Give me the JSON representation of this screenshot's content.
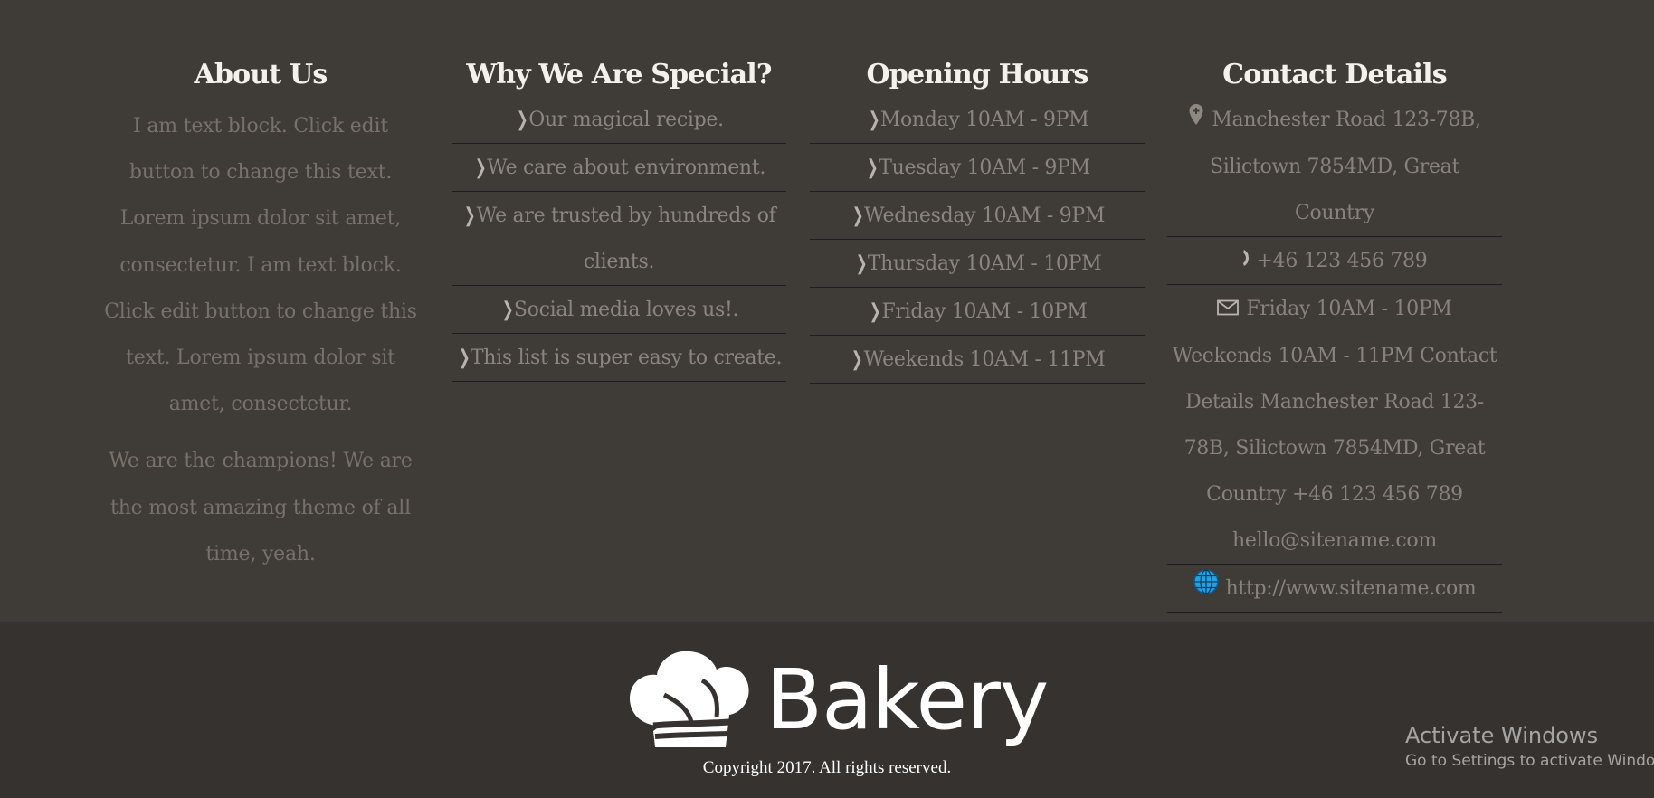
{
  "about": {
    "title": "About Us",
    "paragraph_1": "I am text block. Click edit button to change this text. Lorem ipsum dolor sit amet, consectetur. I am text block. Click edit button to change this text. Lorem ipsum dolor sit amet, consectetur.",
    "paragraph_2": "We are the champions! We are the most amazing theme of all time, yeah."
  },
  "special": {
    "title": "Why We Are Special?",
    "items": [
      "Our magical recipe.",
      "We care about environment.",
      "We are trusted by hundreds of clients.",
      "Social media loves us!.",
      "This list is super easy to create."
    ]
  },
  "hours": {
    "title": "Opening Hours",
    "items": [
      "Monday 10AM - 9PM",
      "Tuesday 10AM - 9PM",
      "Wednesday 10AM - 9PM",
      "Thursday 10AM - 10PM",
      "Friday 10AM - 10PM",
      "Weekends 10AM - 11PM"
    ]
  },
  "contact": {
    "title": "Contact Details",
    "address": "Manchester Road 123-78B, Silictown 7854MD, Great Country",
    "phone": "+46 123 456 789",
    "email_block": "Friday 10AM - 10PM Weekends 10AM - 11PM Contact Details Manchester Road 123-78B, Silictown 7854MD, Great Country +46 123 456 789 hello@sitename.com",
    "website": "http://www.sitename.com"
  },
  "footer": {
    "logo_text": "Bakery",
    "copyright": "Copyright 2017. All rights reserved."
  },
  "windows_watermark": {
    "title": "Activate Windows",
    "subtitle": "Go to Settings to activate Windows."
  },
  "colors": {
    "background": "#3f3b37",
    "bottom_bar": "#353230",
    "heading": "#f4f1ec",
    "text_muted": "#76716b"
  },
  "icons": {
    "list_bullet": "chevron-right-icon",
    "address": "map-pin-icon",
    "phone": "phone-icon",
    "email": "envelope-icon",
    "website": "globe-icon",
    "logo": "chef-hat-icon"
  }
}
